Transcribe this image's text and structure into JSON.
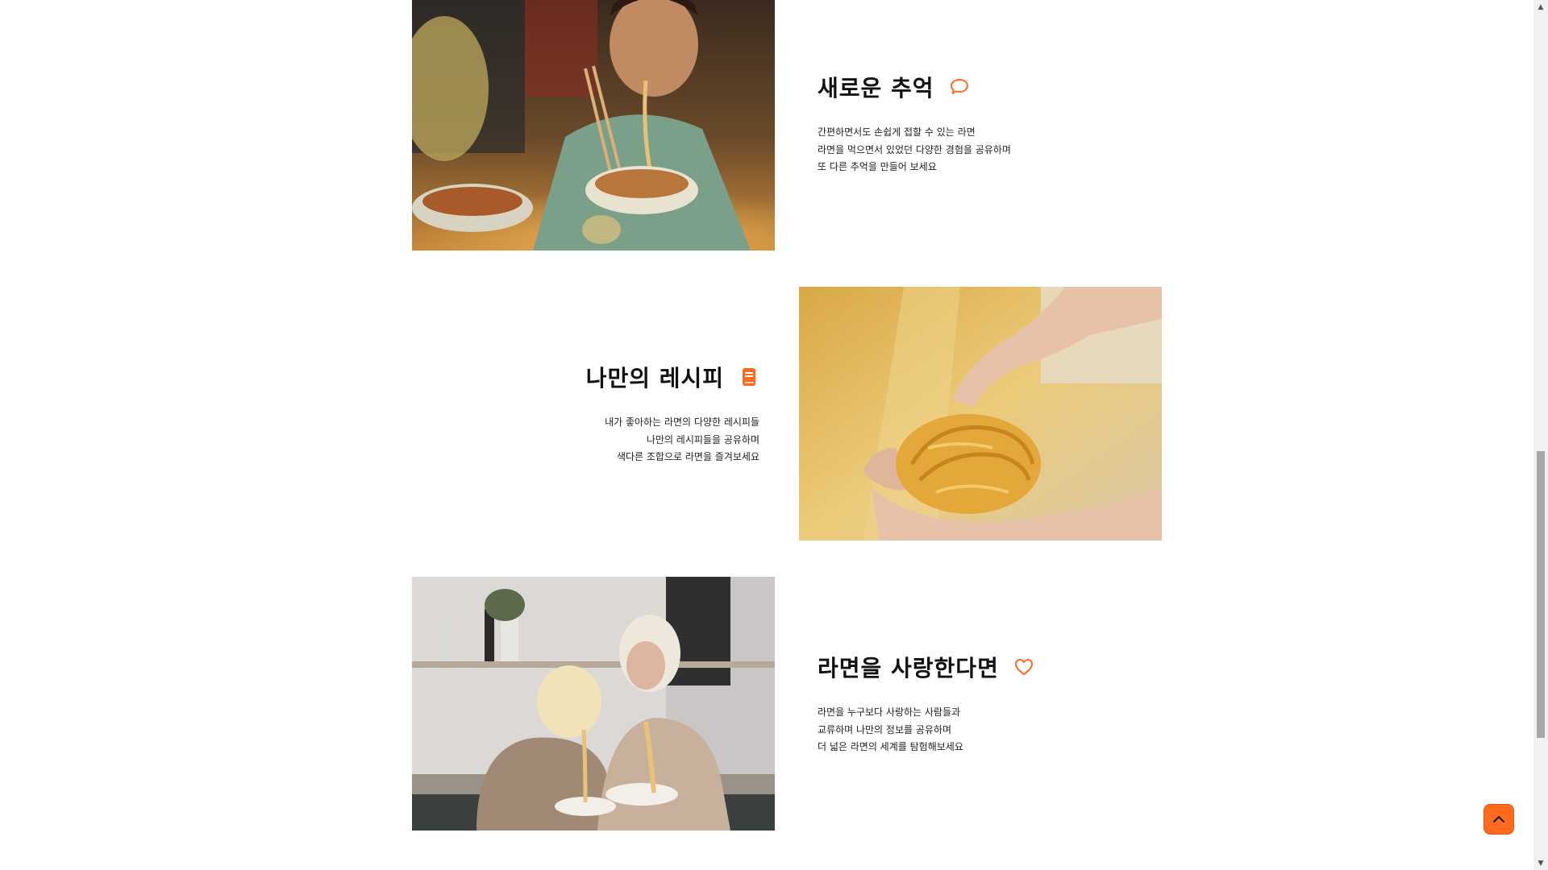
{
  "features": [
    {
      "title": "새로운 추억",
      "icon": "speech-bubble-icon",
      "lines": [
        "간편하면서도 손쉽게 접할 수 있는 라면",
        "라면을 먹으면서 있었던 다양한 경험을 공유하며",
        "또 다른 추억을 만들어 보세요"
      ]
    },
    {
      "title": "나만의 레시피",
      "icon": "book-icon",
      "lines": [
        "내가 좋아하는 라면의 다양한 레시피들",
        "나만의 레시피들을 공유하며",
        "색다른 조합으로 라면을 즐겨보세요"
      ]
    },
    {
      "title": "라면을 사랑한다면",
      "icon": "heart-icon",
      "lines": [
        "라면을 누구보다 사랑하는 사람들과",
        "교류하며 나만의 정보를 공유하며",
        "더 넓은 라면의 세계를 탐험해보세요"
      ]
    }
  ],
  "colors": {
    "accent": "#ff6a1f",
    "text": "#111111"
  }
}
